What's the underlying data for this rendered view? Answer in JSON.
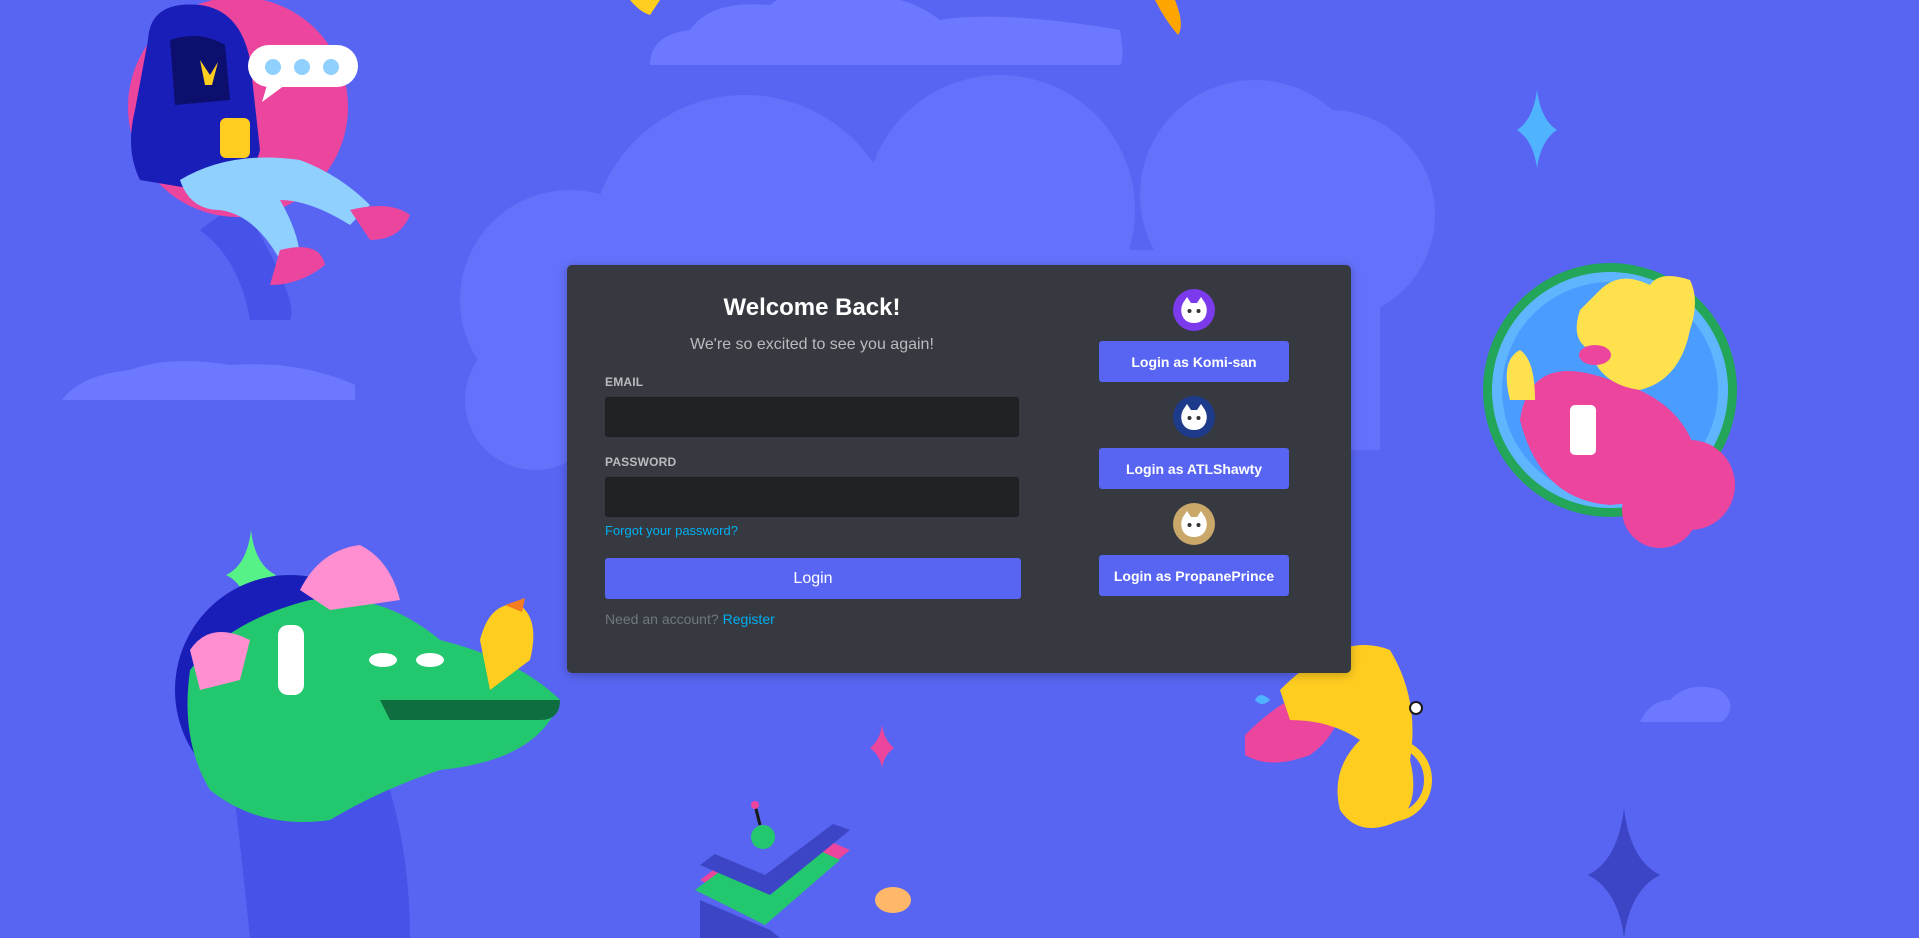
{
  "login": {
    "title": "Welcome Back!",
    "subtitle": "We're so excited to see you again!",
    "email_label": "EMAIL",
    "email_value": "",
    "password_label": "PASSWORD",
    "password_value": "",
    "forgot_label": "Forgot your password?",
    "login_label": "Login",
    "register_prompt": "Need an account?",
    "register_label": "Register"
  },
  "quick_logins": [
    {
      "label": "Login as Komi-san",
      "avatar_color": "#7c3aed",
      "icon": "discord-avatar-icon"
    },
    {
      "label": "Login as ATLShawty",
      "avatar_color": "#1e3a8a",
      "icon": "discord-avatar-icon"
    },
    {
      "label": "Login as PropanePrince",
      "avatar_color": "#c9a86a",
      "icon": "discord-avatar-icon"
    }
  ],
  "colors": {
    "background": "#5865f2",
    "card": "#36393f",
    "input": "#202225",
    "accent": "#5865f2",
    "link": "#00aff4"
  }
}
